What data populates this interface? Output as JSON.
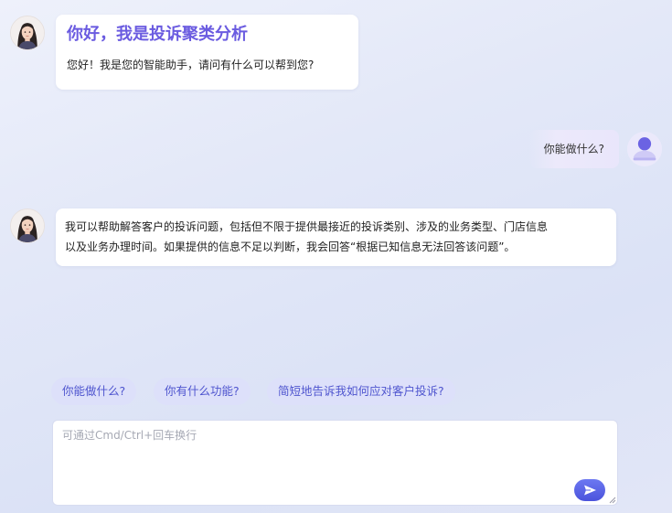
{
  "messages": {
    "greeting": {
      "title": "你好，我是投诉聚类分析",
      "text": "您好！我是您的智能助手，请问有什么可以帮到您?"
    },
    "user_question": "你能做什么?",
    "answer": {
      "line1": "我可以帮助解答客户的投诉问题，包括但不限于提供最接近的投诉类别、涉及的业务类型、门店信息",
      "line2": "以及业务办理时间。如果提供的信息不足以判断，我会回答“根据已知信息无法回答该问题”。"
    }
  },
  "suggestions": [
    "你能做什么?",
    "你有什么功能?",
    "简短地告诉我如何应对客户投诉?"
  ],
  "input": {
    "placeholder": "可通过Cmd/Ctrl+回车换行",
    "value": ""
  },
  "icons": {
    "assistant_avatar": "assistant-avatar-icon",
    "user_avatar": "user-avatar-icon",
    "send": "send-icon"
  },
  "colors": {
    "accent": "#6a5be0",
    "chip_bg": "#dde0fa",
    "chip_text": "#4f55cf",
    "send_button": "#5b64e6"
  }
}
